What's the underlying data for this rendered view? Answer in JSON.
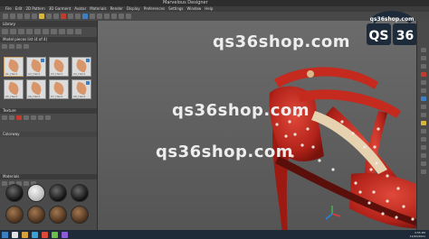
{
  "window": {
    "title": "Marvelous Designer"
  },
  "menu": [
    "File",
    "Edit",
    "2D Pattern",
    "3D Garment",
    "Avatar",
    "Materials",
    "Render",
    "Display",
    "Preferences",
    "Settings",
    "Window",
    "Help"
  ],
  "library": {
    "header": "Library",
    "title": "Model pieces list (4 of 4)",
    "thumbnails": [
      {
        "label": "01_Hand"
      },
      {
        "label": "02_Hand"
      },
      {
        "label": "03_Hand"
      },
      {
        "label": "04_Hand"
      },
      {
        "label": "05_Hand"
      },
      {
        "label": "06_Hand"
      },
      {
        "label": "07_Hand"
      },
      {
        "label": "08_Hand"
      }
    ]
  },
  "sections": {
    "texture": "Texture",
    "material": "Materials",
    "colorway": "Colorway"
  },
  "watermarks": [
    "qs36shop.com",
    "qs36shop.com",
    "qs36shop.com"
  ],
  "logo": {
    "top_text": "qs36shop.com",
    "left": "QS",
    "right": "36"
  },
  "taskbar": {
    "time": "4:55 PM",
    "date": "12/20/2021"
  },
  "colors": {
    "shoe": "#c42a1e",
    "accent": "#3d7fc2"
  }
}
